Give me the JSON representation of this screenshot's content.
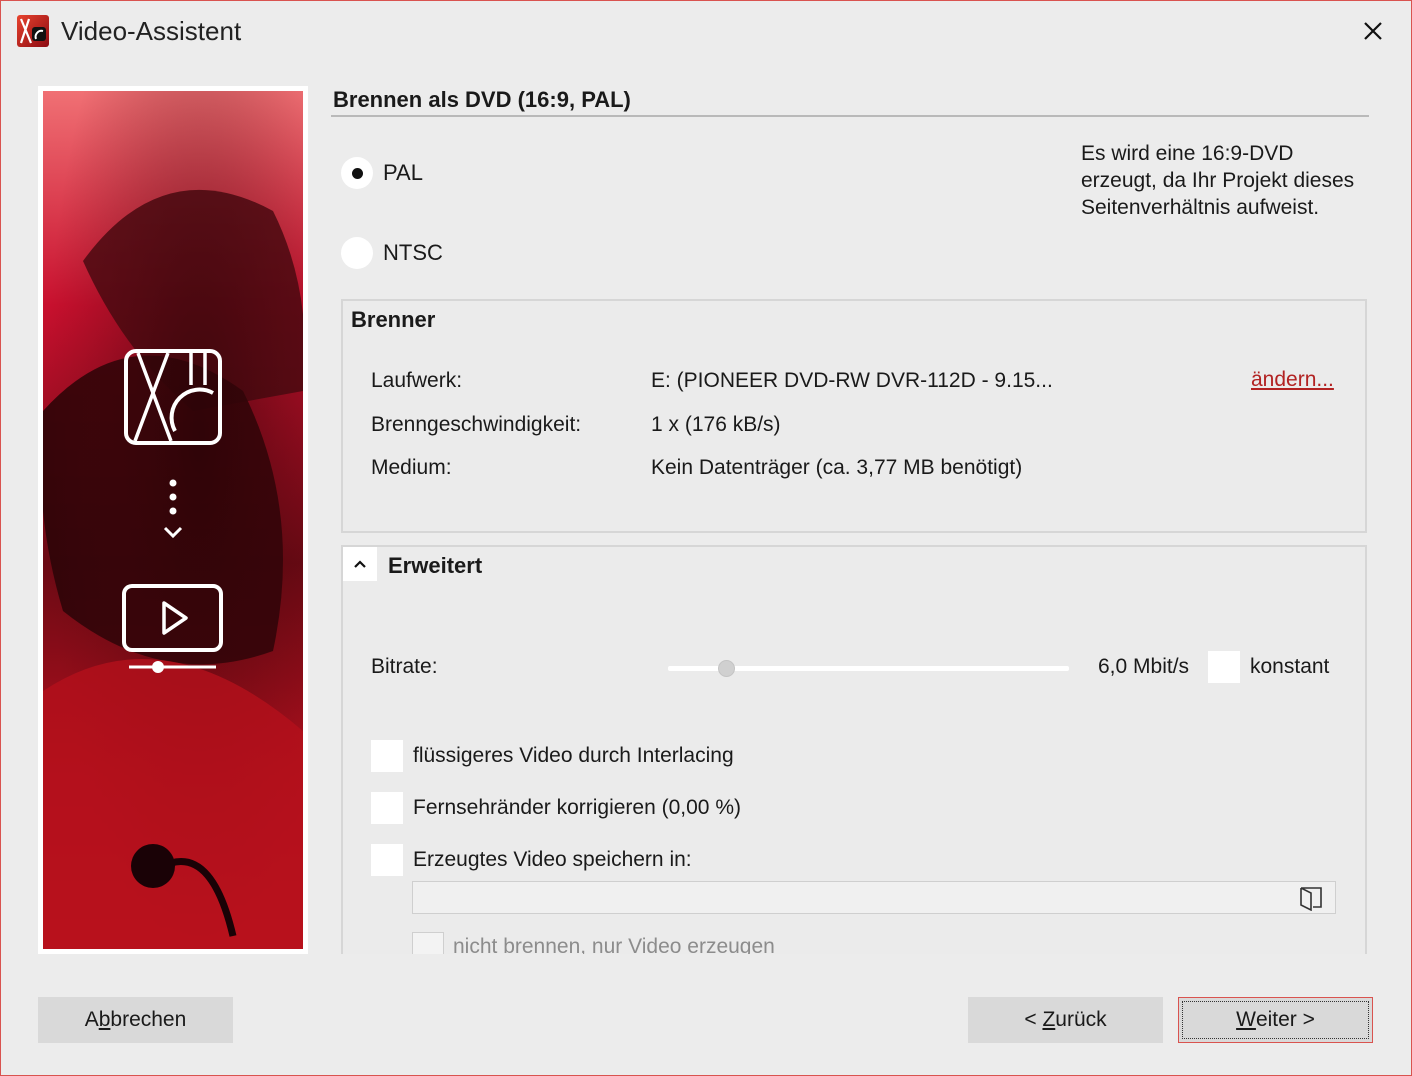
{
  "window": {
    "title": "Video-Assistent"
  },
  "heading": "Brennen als DVD (16:9, PAL)",
  "format": {
    "options": [
      "PAL",
      "NTSC"
    ],
    "selected": "PAL"
  },
  "info": "Es wird eine 16:9-DVD erzeugt, da Ihr Projekt dieses Seitenverhältnis aufweist.",
  "burner": {
    "title": "Brenner",
    "drive_label": "Laufwerk:",
    "drive_value": "E: (PIONEER DVD-RW  DVR-112D - 9.15...",
    "change_link": "ändern...",
    "speed_label": "Brenngeschwindigkeit:",
    "speed_value": "1 x (176 kB/s)",
    "medium_label": "Medium:",
    "medium_value": "Kein Datenträger (ca. 3,77 MB benötigt)"
  },
  "advanced": {
    "title": "Erweitert",
    "bitrate_label": "Bitrate:",
    "bitrate_value": "6,0 Mbit/s",
    "bitrate_fraction": 0.145,
    "constant_label": "konstant",
    "constant_checked": false,
    "interlacing_label": "flüssigeres Video durch Interlacing",
    "interlacing_checked": false,
    "tv_edges_label": "Fernsehränder korrigieren (0,00 %)",
    "tv_edges_checked": false,
    "save_video_label": "Erzeugtes Video speichern in:",
    "save_video_checked": false,
    "save_path": "",
    "no_burn_label": "nicht brennen, nur Video erzeugen",
    "no_burn_checked": false
  },
  "buttons": {
    "cancel": {
      "pre": "A",
      "u": "b",
      "post": "brechen"
    },
    "back": {
      "pre": "< ",
      "u": "Z",
      "post": "urück"
    },
    "next": {
      "pre": "",
      "u": "W",
      "post": "eiter >"
    }
  },
  "colors": {
    "accent": "#d9534f",
    "link": "#b22222",
    "background": "#ececec",
    "side_image_red": "#c8102e"
  },
  "icons": [
    "app-logo-icon",
    "close-icon",
    "film-reel-icon",
    "arrow-down-icon",
    "video-player-icon",
    "chevron-up-icon",
    "folder-icon"
  ]
}
